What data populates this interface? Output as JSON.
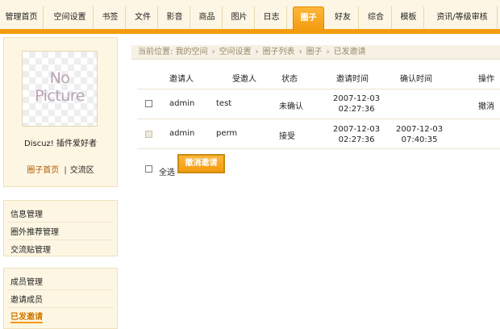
{
  "nav": {
    "tabs": [
      "管理首页",
      "空间设置",
      "书签",
      "文件",
      "影音",
      "商品",
      "图片",
      "日志",
      "圈子",
      "好友",
      "综合",
      "模板",
      "资讯/等级审核"
    ],
    "active": "圈子"
  },
  "profile": {
    "avatar_text_line1": "No",
    "avatar_text_line2": "Picture",
    "username": "Discuz! 插件爱好者",
    "link_home": "圈子首页",
    "separator": "|",
    "link_forum": "交流区"
  },
  "sidebar": {
    "group1": [
      "信息管理",
      "圈外推荐管理",
      "交流贴管理"
    ],
    "group2": [
      "成员管理",
      "邀请成员",
      "已发邀请"
    ],
    "current": "已发邀请"
  },
  "breadcrumb": {
    "prefix": "当前位置:",
    "items": [
      "我的空间",
      "空间设置",
      "圈子列表",
      "圈子",
      "已发邀请"
    ],
    "separator": "›"
  },
  "table": {
    "headers": {
      "inviter": "邀请人",
      "invitee": "受邀人",
      "status": "状态",
      "invite_time": "邀请时间",
      "confirm_time": "确认时间",
      "action": "操作"
    },
    "rows": [
      {
        "inviter": "admin",
        "invitee": "test",
        "status": "未确认",
        "invite_date": "2007-12-03",
        "invite_clock": "02:27:36",
        "confirm_date": "",
        "confirm_clock": "",
        "action": "撤消"
      },
      {
        "inviter": "admin",
        "invitee": "perm",
        "status": "接受",
        "invite_date": "2007-12-03",
        "invite_clock": "02:27:36",
        "confirm_date": "2007-12-03",
        "confirm_clock": "07:40:35",
        "action": ""
      }
    ]
  },
  "footer": {
    "select_all": "全选",
    "revoke_button": "撤消邀请"
  }
}
